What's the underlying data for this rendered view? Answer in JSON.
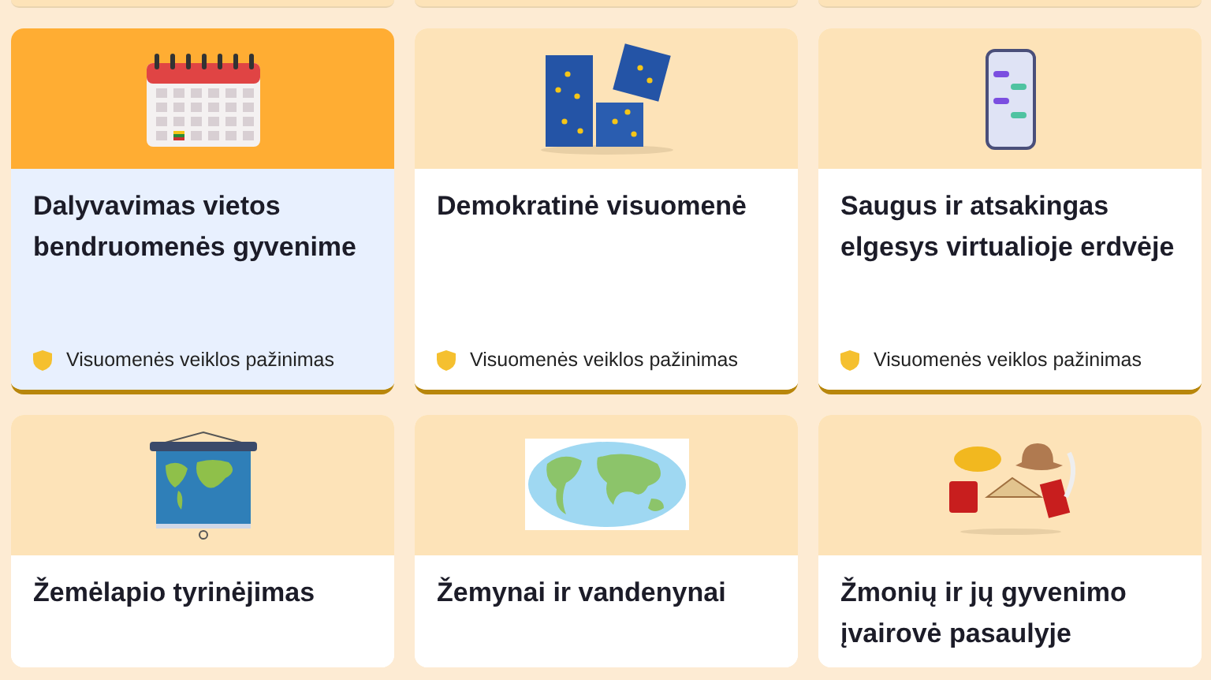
{
  "cards": [
    {
      "title": "Dalyvavimas vietos bendruomenės gyvenime",
      "category": "Visuomenės veiklos pažinimas",
      "kind": "calendar",
      "selected": true
    },
    {
      "title": "Demokratinė visuomenė",
      "category": "Visuomenės veiklos pažinimas",
      "kind": "puzzle",
      "selected": false
    },
    {
      "title": "Saugus ir atsakingas elgesys virtualioje erdvėje",
      "category": "Visuomenės veiklos pažinimas",
      "kind": "phone",
      "selected": false
    },
    {
      "title": "Žemėlapio tyrinėjimas",
      "kind": "wallmap",
      "selected": false
    },
    {
      "title": "Žemynai ir vandenynai",
      "kind": "worldmap",
      "selected": false
    },
    {
      "title": "Žmonių ir jų gyvenimo įvairovė pasaulyje",
      "kind": "hats",
      "selected": false
    }
  ]
}
